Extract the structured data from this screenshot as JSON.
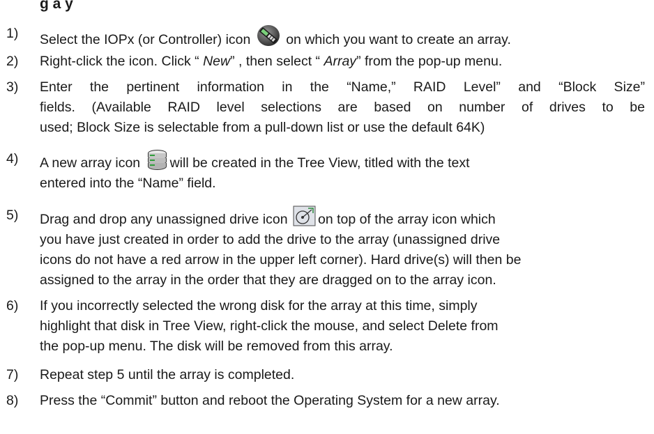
{
  "heading": "g a      y",
  "steps": [
    {
      "number": "1)",
      "lines": [
        {
          "before": "Select the IOPx (or Controller) icon",
          "icon": "iopx-controller-icon",
          "after": " on which you want to create an array."
        }
      ]
    },
    {
      "number": "2)",
      "lines": [
        {
          "a": "Right-click the icon. Click “ ",
          "b": "New",
          "c": "” , then select “ ",
          "d": "Array",
          "e": "”  from the pop-up menu."
        }
      ]
    },
    {
      "number": "3)",
      "lines": [
        "Enter the pertinent information in the “Name,” RAID Level” and “Block Size”",
        "fields. (Available RAID level selections are based on number of drives to be",
        "used; Block Size is selectable from a pull-down list or use the default 64K)"
      ]
    },
    {
      "number": "4)",
      "lines": [
        {
          "before": "A new array icon",
          "icon": "array-icon",
          "after": "will be created in the Tree View, titled with the text"
        },
        "entered into the “Name” field."
      ]
    },
    {
      "number": "5)",
      "lines": [
        {
          "before": "Drag and drop any unassigned drive icon",
          "icon": "unassigned-drive-icon",
          "after": "on top of the array icon which"
        },
        "you have just created in order to add the drive to the array (unassigned drive",
        "icons do not have a red arrow in the upper left corner). Hard drive(s) will then be",
        "assigned to the array in the order that they are dragged on to the array icon."
      ]
    },
    {
      "number": "6)",
      "lines": [
        "If you incorrectly selected the wrong disk for the array at this time, simply",
        "highlight that disk in Tree View, right-click the mouse, and select Delete from",
        "the pop-up menu. The disk will be removed from this array."
      ]
    },
    {
      "number": "7)",
      "lines": [
        "Repeat step 5 until the array is completed."
      ]
    },
    {
      "number": "8)",
      "lines": [
        "Press the “Commit” button and reboot the Operating System for a new array."
      ]
    }
  ]
}
